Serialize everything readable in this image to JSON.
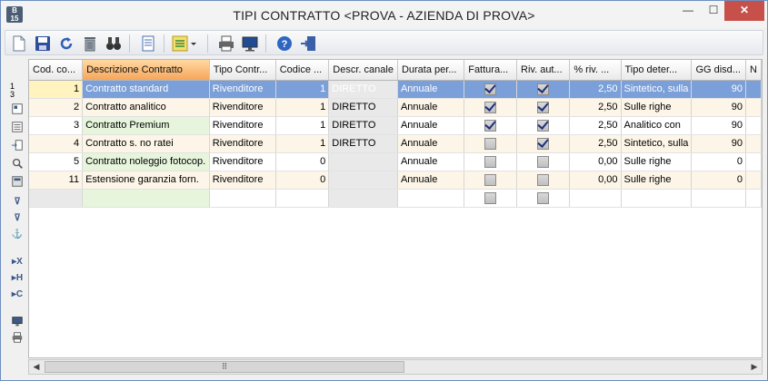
{
  "window": {
    "title": "TIPI CONTRATTO <PROVA - AZIENDA DI PROVA>",
    "app_icon_top": "B",
    "app_icon_bottom": "15",
    "minimize_glyph": "—",
    "maximize_glyph": "☐",
    "close_glyph": "✕"
  },
  "toolbar": {
    "icons": [
      "new-document-icon",
      "save-icon",
      "refresh-icon",
      "delete-icon",
      "binoculars-icon",
      "page-icon",
      "list-dropdown-icon",
      "print-icon",
      "monitor-icon",
      "help-icon",
      "exit-icon"
    ]
  },
  "leftbar": {
    "row_counter_top": "1",
    "row_counter_bottom": "3",
    "glyphs": {
      "filter": "⊽",
      "filter_remove": "⊽",
      "anchor": "⚓",
      "x": "▸X",
      "h": "▸H",
      "c": "▸C"
    }
  },
  "grid": {
    "columns": [
      "Cod. co...",
      "Descrizione Contratto",
      "Tipo Contr...",
      "Codice ...",
      "Descr. canale",
      "Durata per...",
      "Fattura...",
      "Riv. aut...",
      "% riv. ...",
      "Tipo deter...",
      "GG disd...",
      "N"
    ],
    "rows": [
      {
        "code": "1",
        "desc": "Contratto standard",
        "tipo": "Rivenditore",
        "codice": "1",
        "canale": "DIRETTO",
        "durata": "Annuale",
        "fattura": true,
        "riv": true,
        "perc": "2,50",
        "tipo_det": "Sintetico, sulla",
        "gg": "90"
      },
      {
        "code": "2",
        "desc": "Contratto analitico",
        "tipo": "Rivenditore",
        "codice": "1",
        "canale": "DIRETTO",
        "durata": "Annuale",
        "fattura": true,
        "riv": true,
        "perc": "2,50",
        "tipo_det": "Sulle righe",
        "gg": "90"
      },
      {
        "code": "3",
        "desc": "Contratto Premium",
        "tipo": "Rivenditore",
        "codice": "1",
        "canale": "DIRETTO",
        "durata": "Annuale",
        "fattura": true,
        "riv": true,
        "perc": "2,50",
        "tipo_det": "Analitico con",
        "gg": "90"
      },
      {
        "code": "4",
        "desc": "Contratto s. no ratei",
        "tipo": "Rivenditore",
        "codice": "1",
        "canale": "DIRETTO",
        "durata": "Annuale",
        "fattura": false,
        "riv": true,
        "perc": "2,50",
        "tipo_det": "Sintetico, sulla",
        "gg": "90"
      },
      {
        "code": "5",
        "desc": "Contratto noleggio fotocop.",
        "tipo": "Rivenditore",
        "codice": "0",
        "canale": "",
        "durata": "Annuale",
        "fattura": false,
        "riv": false,
        "perc": "0,00",
        "tipo_det": "Sulle righe",
        "gg": "0"
      },
      {
        "code": "11",
        "desc": "Estensione garanzia forn.",
        "tipo": "Rivenditore",
        "codice": "0",
        "canale": "",
        "durata": "Annuale",
        "fattura": false,
        "riv": false,
        "perc": "0,00",
        "tipo_det": "Sulle righe",
        "gg": "0"
      }
    ]
  },
  "scrollbar": {
    "left_arrow": "◀",
    "right_arrow": "▶",
    "thumb_grip": "⠿"
  }
}
